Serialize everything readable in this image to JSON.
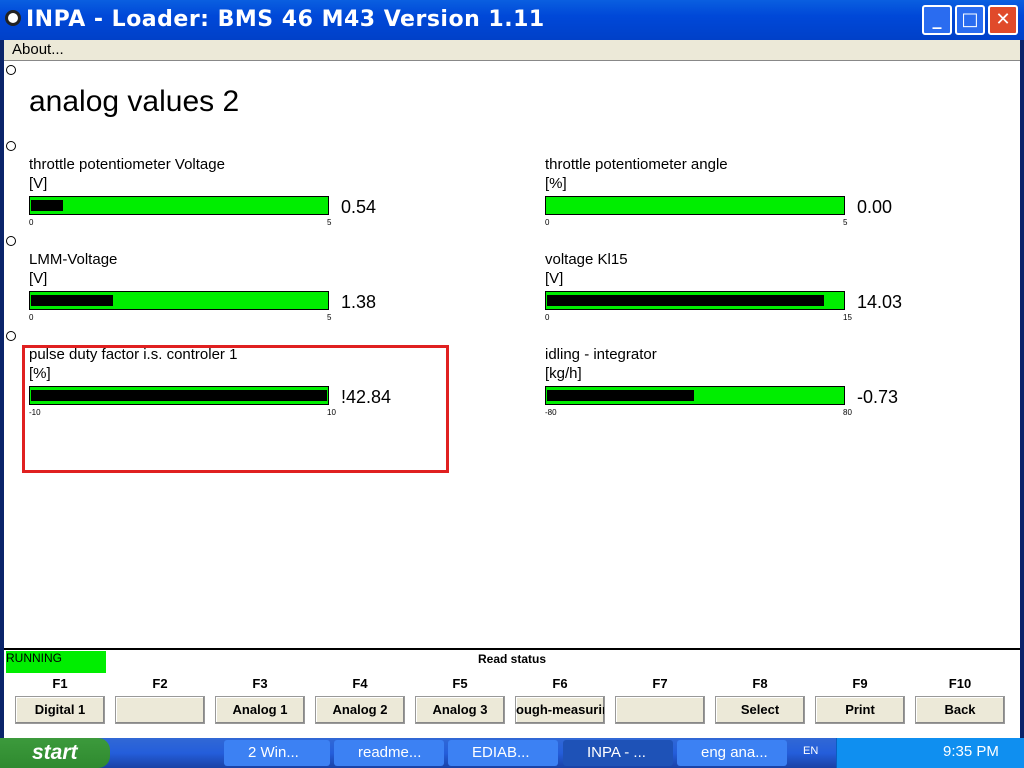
{
  "window": {
    "title": "INPA - Loader:  BMS 46 M43 Version 1.11",
    "menu": "About..."
  },
  "page_title": "analog values 2",
  "gauges": [
    {
      "label": "throttle potentiometer Voltage",
      "unit": "[V]",
      "min": "0",
      "max": "5",
      "value": "0.54",
      "fraction": 0.108
    },
    {
      "label": "throttle potentiometer angle",
      "unit": "[%]",
      "min": "0",
      "max": "5",
      "value": "0.00",
      "fraction": 0.0
    },
    {
      "label": "LMM-Voltage",
      "unit": "[V]",
      "min": "0",
      "max": "5",
      "value": "1.38",
      "fraction": 0.276
    },
    {
      "label": "voltage Kl15",
      "unit": "[V]",
      "min": "0",
      "max": "15",
      "value": "14.03",
      "fraction": 0.935
    },
    {
      "label": "pulse duty factor i.s. controler 1",
      "unit": "[%]",
      "min": "-10",
      "max": "10",
      "value": "!42.84",
      "fraction": 1.0
    },
    {
      "label": "idling - integrator",
      "unit": "[kg/h]",
      "min": "-80",
      "max": "80",
      "value": "-0.73",
      "fraction": 0.495
    }
  ],
  "status": {
    "running": "RUNNING",
    "read_status": "Read status"
  },
  "fkeys": [
    {
      "key": "F1",
      "label": "Digital 1"
    },
    {
      "key": "F2",
      "label": ""
    },
    {
      "key": "F3",
      "label": "Analog 1"
    },
    {
      "key": "F4",
      "label": "Analog 2"
    },
    {
      "key": "F5",
      "label": "Analog 3"
    },
    {
      "key": "F6",
      "label": "ough-measurin"
    },
    {
      "key": "F7",
      "label": ""
    },
    {
      "key": "F8",
      "label": "Select"
    },
    {
      "key": "F9",
      "label": "Print"
    },
    {
      "key": "F10",
      "label": "Back"
    }
  ],
  "taskbar": {
    "start": "start",
    "items": [
      "2 Win...",
      "readme...",
      "EDIAB...",
      "INPA - ...",
      "eng ana..."
    ],
    "lang": "EN",
    "clock": "9:35 PM"
  }
}
